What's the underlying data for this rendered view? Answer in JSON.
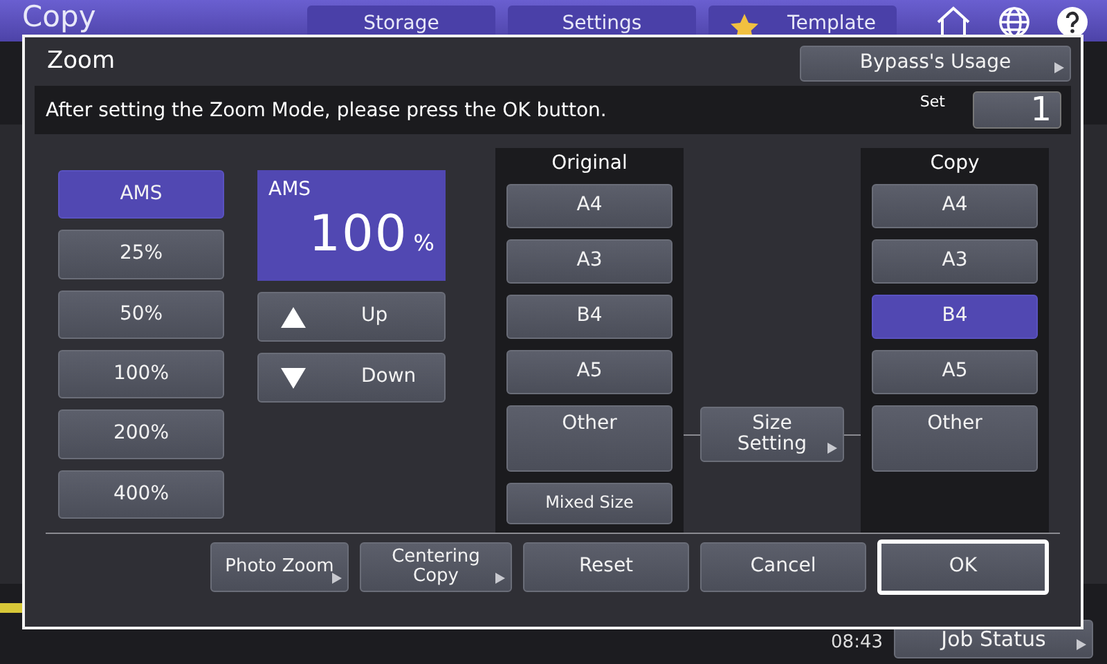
{
  "header": {
    "title": "Copy",
    "tabs": [
      {
        "label": "Storage",
        "kind": "plain"
      },
      {
        "label": "Settings",
        "kind": "plain"
      },
      {
        "label": "Template",
        "kind": "starred"
      }
    ]
  },
  "dialog": {
    "title": "Zoom",
    "bypass_button": "Bypass's Usage",
    "message": "After setting the Zoom Mode, please press the OK button.",
    "set_label": "Set",
    "set_value": "1",
    "zoom_presets": [
      {
        "label": "AMS",
        "selected": true
      },
      {
        "label": "25%",
        "selected": false
      },
      {
        "label": "50%",
        "selected": false
      },
      {
        "label": "100%",
        "selected": false
      },
      {
        "label": "200%",
        "selected": false
      },
      {
        "label": "400%",
        "selected": false
      }
    ],
    "display": {
      "mode": "AMS",
      "value": "100",
      "unit": "%"
    },
    "adjust_buttons": [
      {
        "label": "Up",
        "kind": "up"
      },
      {
        "label": "Down",
        "kind": "down"
      }
    ],
    "original": {
      "heading": "Original",
      "sizes": [
        {
          "label": "A4",
          "kind": "normal",
          "selected": false
        },
        {
          "label": "A3",
          "kind": "normal",
          "selected": false
        },
        {
          "label": "B4",
          "kind": "normal",
          "selected": false
        },
        {
          "label": "A5",
          "kind": "normal",
          "selected": false
        },
        {
          "label": "Other",
          "kind": "tall",
          "selected": false
        },
        {
          "label": "Mixed Size",
          "kind": "small",
          "selected": false
        }
      ]
    },
    "size_setting": "Size Setting",
    "copy": {
      "heading": "Copy",
      "sizes": [
        {
          "label": "A4",
          "kind": "normal",
          "selected": false
        },
        {
          "label": "A3",
          "kind": "normal",
          "selected": false
        },
        {
          "label": "B4",
          "kind": "normal",
          "selected": true
        },
        {
          "label": "A5",
          "kind": "normal",
          "selected": false
        },
        {
          "label": "Other",
          "kind": "tall",
          "selected": false
        }
      ]
    },
    "actions": [
      {
        "label": "Photo Zoom",
        "has_more": true,
        "focused": false
      },
      {
        "label": "Centering Copy",
        "has_more": true,
        "focused": false
      },
      {
        "label": "Reset",
        "has_more": false,
        "focused": false
      },
      {
        "label": "Cancel",
        "has_more": false,
        "focused": false
      },
      {
        "label": "OK",
        "has_more": false,
        "focused": true
      }
    ]
  },
  "status": {
    "time": "08:43",
    "job_status": "Job Status"
  }
}
